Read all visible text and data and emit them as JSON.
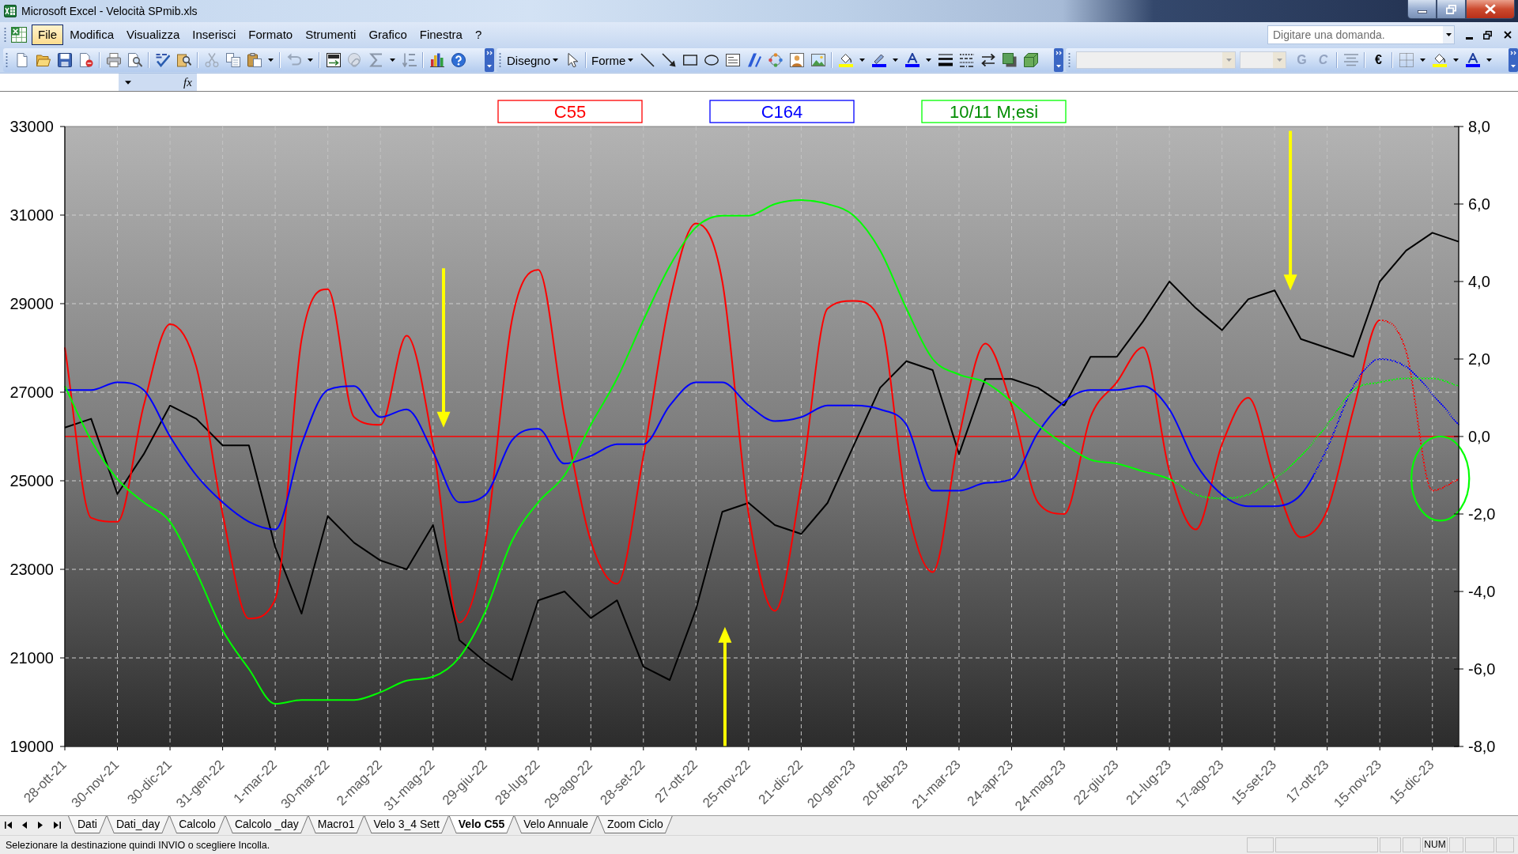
{
  "window": {
    "title": "Microsoft Excel - Velocità SPmib.xls"
  },
  "menu": [
    {
      "label": "File",
      "selected": true
    },
    {
      "label": "Modifica",
      "selected": false
    },
    {
      "label": "Visualizza",
      "selected": false
    },
    {
      "label": "Inserisci",
      "selected": false
    },
    {
      "label": "Formato",
      "selected": false
    },
    {
      "label": "Strumenti",
      "selected": false
    },
    {
      "label": "Grafico",
      "selected": false
    },
    {
      "label": "Finestra",
      "selected": false
    },
    {
      "label": "?",
      "selected": false
    }
  ],
  "help_search": {
    "placeholder": "Digitare una domanda."
  },
  "drawing_toolbar": {
    "menus": [
      {
        "label": "Disegno"
      },
      {
        "label": "Forme"
      }
    ]
  },
  "formatting_toolbar": {
    "text_buttons": [
      {
        "kind": "bold",
        "label": "G",
        "disabled": true
      },
      {
        "kind": "italic",
        "label": "C",
        "disabled": true
      },
      {
        "kind": "symbol",
        "label": "€",
        "disabled": false
      }
    ]
  },
  "formula_bar": {
    "function_label": "fx"
  },
  "chart": {
    "chart_data": {
      "type": "line",
      "categories": [
        "28-ott-21",
        null,
        "30-nov-21",
        null,
        "30-dic-21",
        null,
        "31-gen-22",
        null,
        "1-mar-22",
        null,
        "30-mar-22",
        null,
        "2-mag-22",
        null,
        "31-mag-22",
        null,
        "29-giu-22",
        null,
        "28-lug-22",
        null,
        "29-ago-22",
        null,
        "28-set-22",
        null,
        "27-ott-22",
        null,
        "25-nov-22",
        null,
        "21-dic-22",
        null,
        "20-gen-23",
        null,
        "20-feb-23",
        null,
        "21-mar-23",
        null,
        "24-apr-23",
        null,
        "24-mag-23",
        null,
        "22-giu-23",
        null,
        "21-lug-23",
        null,
        "17-ago-23",
        null,
        "15-set-23",
        null,
        "17-ott-23",
        null,
        "15-nov-23",
        null,
        "15-dic-23",
        null
      ],
      "ylim": [
        19000,
        33000
      ],
      "yticks": [
        19000,
        21000,
        23000,
        25000,
        27000,
        29000,
        31000,
        33000
      ],
      "y2lim": [
        -8,
        8
      ],
      "y2ticks": [
        {
          "value": -8,
          "label": "-8,0"
        },
        {
          "value": -6,
          "label": "-6,0"
        },
        {
          "value": -4,
          "label": "-4,0"
        },
        {
          "value": -2,
          "label": "-2,0"
        },
        {
          "value": 0,
          "label": "0,0"
        },
        {
          "value": 2,
          "label": "2,0"
        },
        {
          "value": 4,
          "label": "4,0"
        },
        {
          "value": 6,
          "label": "6,0"
        },
        {
          "value": 8,
          "label": "8,0"
        }
      ],
      "grid": true,
      "series": [
        {
          "color": "#000000",
          "values": [
            26200,
            26400,
            24700,
            25600,
            26700,
            26400,
            25800,
            25800,
            23500,
            22000,
            24200,
            23600,
            23200,
            23000,
            24000,
            21400,
            20900,
            20500,
            22300,
            22500,
            21900,
            22300,
            20800,
            20500,
            22100,
            24300,
            24500,
            24000,
            23800,
            24500,
            25800,
            27100,
            27700,
            27500,
            25600,
            27300,
            27300,
            27100,
            26700,
            27800,
            27800,
            28600,
            29500,
            28900,
            28400,
            29100,
            29300,
            28200,
            28000,
            27800,
            29500,
            30200,
            30600,
            30400
          ]
        },
        {
          "name": "C55",
          "color": "#ff0000",
          "axis": "y2",
          "values": [
            2.3,
            -2.1,
            -2.2,
            0.8,
            2.9,
            1.8,
            -2.0,
            -4.7,
            -4.2,
            2.5,
            3.8,
            0.5,
            0.3,
            2.6,
            -0.2,
            -4.8,
            -2.7,
            3.0,
            4.3,
            0.5,
            -2.7,
            -3.8,
            -0.5,
            3.5,
            5.5,
            4.0,
            -2.0,
            -4.5,
            -1.2,
            3.3,
            3.5,
            3.0,
            -1.7,
            -3.5,
            0.0,
            2.4,
            0.8,
            -1.7,
            -2.0,
            0.5,
            1.4,
            2.3,
            -0.9,
            -2.4,
            -0.2,
            1.0,
            -1.1,
            -2.6,
            -1.9,
            0.7,
            3.0,
            2.2,
            -1.4,
            -1.1
          ]
        },
        {
          "name": "C164",
          "color": "#0000ff",
          "axis": "y2",
          "values": [
            1.2,
            1.2,
            1.4,
            1.2,
            0.0,
            -1.0,
            -1.7,
            -2.2,
            -2.4,
            -0.2,
            1.2,
            1.3,
            0.5,
            0.7,
            -0.4,
            -1.7,
            -1.5,
            -0.1,
            0.2,
            -0.7,
            -0.5,
            -0.2,
            -0.2,
            0.8,
            1.4,
            1.4,
            0.8,
            0.4,
            0.5,
            0.8,
            0.8,
            0.7,
            0.3,
            -1.4,
            -1.4,
            -1.2,
            -1.1,
            0.1,
            0.9,
            1.2,
            1.2,
            1.3,
            0.7,
            -0.7,
            -1.5,
            -1.8,
            -1.8,
            -1.5,
            -0.3,
            1.3,
            2.0,
            1.8,
            1.1,
            0.3
          ]
        },
        {
          "name": "10/11 M;esi",
          "color": "#00ff00",
          "axis": "y2",
          "values": [
            1.3,
            -0.1,
            -1.1,
            -1.7,
            -2.2,
            -3.5,
            -5.0,
            -6.0,
            -6.9,
            -6.8,
            -6.8,
            -6.8,
            -6.6,
            -6.3,
            -6.2,
            -5.7,
            -4.5,
            -2.7,
            -1.7,
            -1.0,
            0.3,
            1.5,
            3.0,
            4.4,
            5.4,
            5.7,
            5.7,
            6.0,
            6.1,
            6.0,
            5.7,
            4.8,
            3.3,
            2.0,
            1.6,
            1.4,
            0.9,
            0.3,
            -0.2,
            -0.6,
            -0.7,
            -0.9,
            -1.1,
            -1.5,
            -1.6,
            -1.5,
            -1.1,
            -0.5,
            0.3,
            1.2,
            1.4,
            1.5,
            1.5,
            1.3
          ]
        }
      ],
      "ref_lines": [
        {
          "axis": "y2",
          "value": 0,
          "color": "#ff0000"
        }
      ]
    }
  },
  "sheet_tabs": [
    {
      "label": "Dati",
      "selected": false
    },
    {
      "label": "Dati_day",
      "selected": false
    },
    {
      "label": "Calcolo",
      "selected": false
    },
    {
      "label": "Calcolo _day",
      "selected": false
    },
    {
      "label": "Macro1",
      "selected": false
    },
    {
      "label": "Velo 3_4 Sett",
      "selected": false
    },
    {
      "label": "Velo C55",
      "selected": true
    },
    {
      "label": "Velo Annuale",
      "selected": false
    },
    {
      "label": "Zoom Ciclo",
      "selected": false
    }
  ],
  "status_bar": {
    "message": "Selezionare la destinazione quindi INVIO o scegliere Incolla.",
    "indicators": [
      {
        "label": "NUM"
      }
    ]
  }
}
